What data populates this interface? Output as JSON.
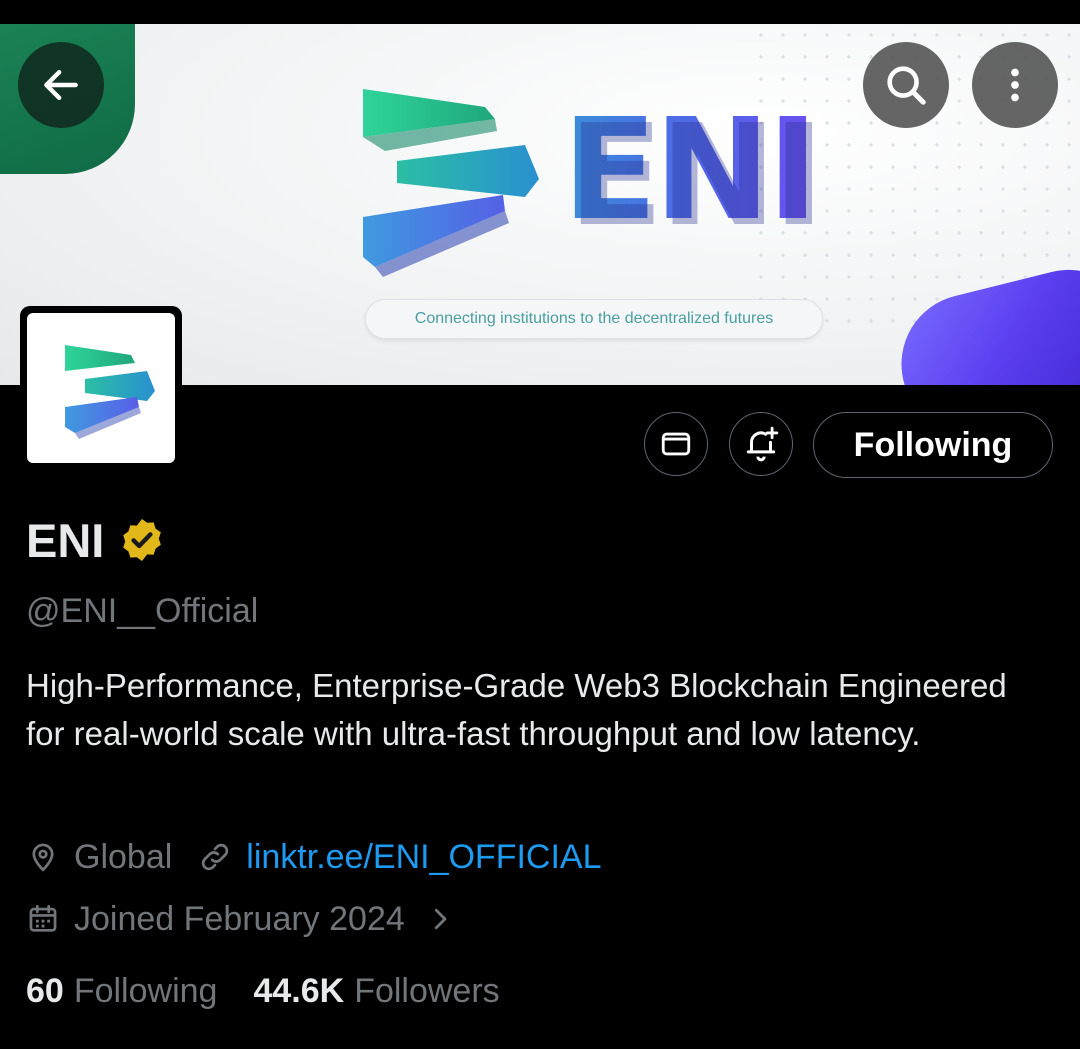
{
  "banner": {
    "brand_word": "ENI",
    "tagline": "Connecting institutions to the decentralized futures"
  },
  "header_buttons": {
    "back_icon": "arrow-left-icon",
    "search_icon": "search-icon",
    "more_icon": "more-vertical-icon"
  },
  "actions": {
    "message_icon": "mail-icon",
    "notify_icon": "bell-plus-icon",
    "follow_label": "Following"
  },
  "profile": {
    "name": "ENI",
    "verified_icon": "verified-badge-icon",
    "handle": "@ENI__Official",
    "bio": "High-Performance, Enterprise-Grade Web3 Blockchain Engineered for real-world scale with ultra-fast throughput and low latency.",
    "location": "Global",
    "website": "linktr.ee/ENI_OFFICIAL",
    "joined": "Joined February 2024",
    "following_count": "60",
    "following_label": "Following",
    "followers_count": "44.6K",
    "followers_label": "Followers"
  },
  "colors": {
    "background": "#000000",
    "text_primary": "#e7e9ea",
    "text_secondary": "#71767b",
    "link": "#1d9bf0",
    "verified_gold": "#e2b719"
  }
}
